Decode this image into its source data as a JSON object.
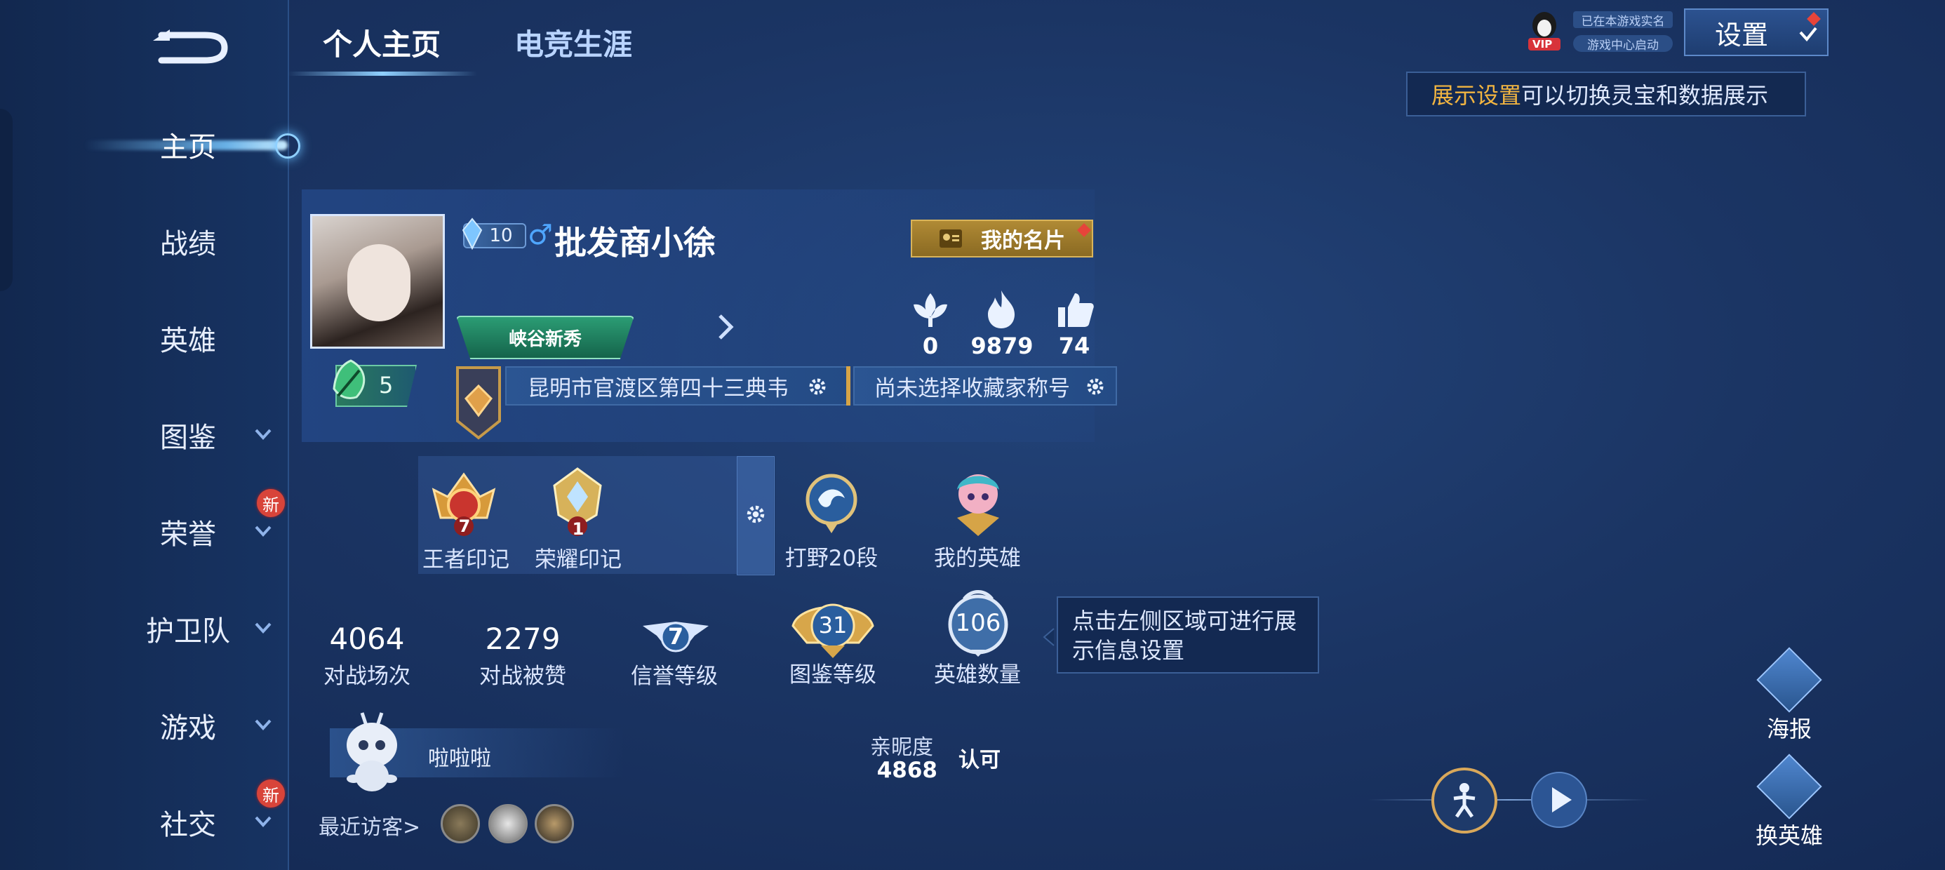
{
  "tabs": [
    {
      "label": "个人主页",
      "active": true
    },
    {
      "label": "电竞生涯",
      "active": false
    }
  ],
  "nav": [
    {
      "label": "主页",
      "active": true,
      "chevron": false,
      "badge": ""
    },
    {
      "label": "战绩",
      "chevron": false,
      "badge": ""
    },
    {
      "label": "英雄",
      "chevron": false,
      "badge": ""
    },
    {
      "label": "图鉴",
      "chevron": true,
      "badge": ""
    },
    {
      "label": "荣誉",
      "chevron": true,
      "badge": "新"
    },
    {
      "label": "护卫队",
      "chevron": true,
      "badge": ""
    },
    {
      "label": "游戏",
      "chevron": true,
      "badge": ""
    },
    {
      "label": "社交",
      "chevron": true,
      "badge": "新"
    }
  ],
  "top_right": {
    "vip_label": "VIP",
    "realname": "已在本游戏实名",
    "gamecenter": "游戏中心启动",
    "settings_label": "设置",
    "tip_highlight": "展示设置",
    "tip_rest": "可以切换灵宝和数据展示"
  },
  "profile": {
    "level": "10",
    "gender_symbol": "♂",
    "name": "批发商小徐",
    "rank_title": "峡谷新秀",
    "card_button": "我的名片",
    "stats": [
      {
        "icon": "lotus-icon",
        "value": "0"
      },
      {
        "icon": "flame-icon",
        "value": "9879"
      },
      {
        "icon": "thumb-up-icon",
        "value": "74"
      }
    ],
    "leaf_level": "5",
    "region_title": "昆明市官渡区第四十三典韦",
    "collector_title": "尚未选择收藏家称号"
  },
  "marks": [
    {
      "label": "王者印记",
      "badge": "7"
    },
    {
      "label": "荣耀印记",
      "badge": "1"
    },
    {
      "label": "打野20段",
      "badge": ""
    },
    {
      "label": "我的英雄",
      "badge": ""
    }
  ],
  "numbers": [
    {
      "value": "4064",
      "label": "对战场次"
    },
    {
      "value": "2279",
      "label": "对战被赞"
    },
    {
      "value": "7",
      "label": "信誉等级"
    },
    {
      "value": "31",
      "label": "图鉴等级"
    },
    {
      "value": "106",
      "label": "英雄数量"
    }
  ],
  "hint": "点击左侧区域可进行展示信息设置",
  "pet": {
    "name": "啦啦啦",
    "intimacy_label": "亲昵度",
    "intimacy_value": "4868",
    "recognize": "认可"
  },
  "visitors_label": "最近访客>",
  "side_buttons": [
    {
      "label": "海报"
    },
    {
      "label": "换英雄"
    }
  ]
}
